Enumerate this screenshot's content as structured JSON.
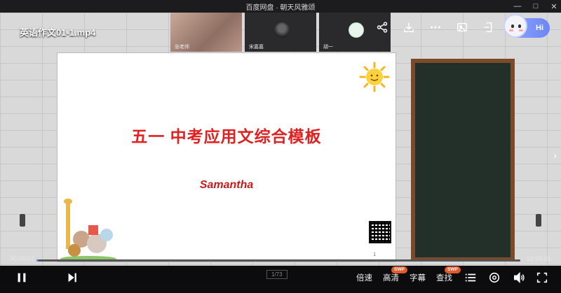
{
  "window": {
    "title": "百度网盘 · 朝天风雅颂",
    "controls": [
      "—",
      "□",
      "✕"
    ]
  },
  "video": {
    "file_name": "英语作文01-1.mp4"
  },
  "assistant": {
    "label": "Hi"
  },
  "cams": [
    {
      "name": "张老师"
    },
    {
      "name": "宋嘉嘉"
    },
    {
      "name": "胡一"
    }
  ],
  "slide": {
    "title": "五一 中考应用文综合模板",
    "author": "Samantha",
    "page": "1"
  },
  "player": {
    "current_time": "00:00:07",
    "total_time": "02:00:01",
    "progress": 0.001,
    "speed_label": "倍速",
    "quality_label": "高清",
    "quality_badge": "SWP",
    "subtitle_label": "字幕",
    "find_label": "查找",
    "find_badge": "SWP",
    "page_indicator": "1/73"
  },
  "colors": {
    "accent": "#4b8dff",
    "slide_title": "#e12020",
    "badge": "#e55a2b"
  },
  "icons": {
    "share": "share-icon",
    "download": "download-icon",
    "more": "more-icon",
    "screenshot": "screenshot-icon",
    "pip": "pip-icon",
    "pause": "pause-icon",
    "next": "next-icon",
    "playlist": "playlist-icon",
    "settings": "settings-icon",
    "volume": "volume-icon",
    "fullscreen": "fullscreen-icon"
  }
}
